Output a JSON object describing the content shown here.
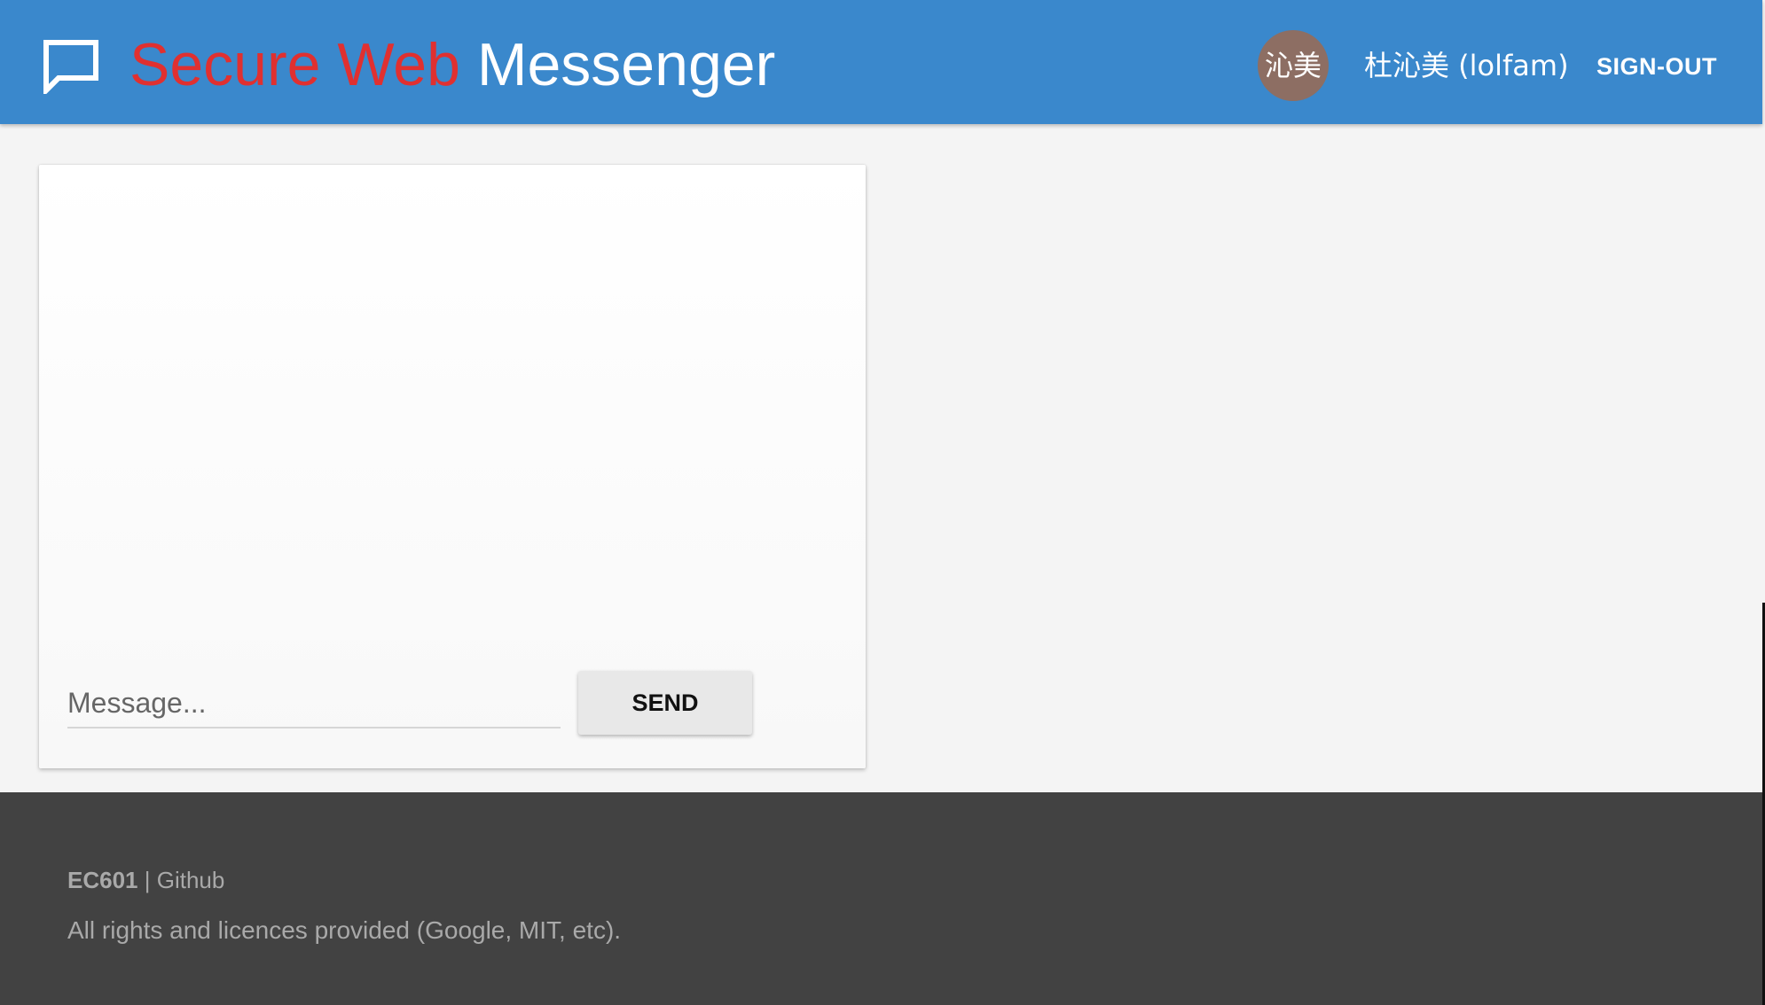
{
  "header": {
    "title_red": "Secure Web",
    "title_white": "Messenger",
    "logo_icon": "chat-bubble-icon",
    "avatar_text": "沁美",
    "user_name": "杜沁美 (lolfam)",
    "signout_label": "SIGN-OUT"
  },
  "composer": {
    "placeholder": "Message...",
    "value": "",
    "send_label": "SEND"
  },
  "footer": {
    "brand": "EC601",
    "separator": "|",
    "github_label": "Github",
    "copyright": "All rights and licences provided (Google, MIT, etc)."
  },
  "colors": {
    "header_bg": "#3a88cc",
    "title_accent": "#e03030",
    "avatar_bg": "#8d6e63",
    "footer_bg": "#424242"
  }
}
